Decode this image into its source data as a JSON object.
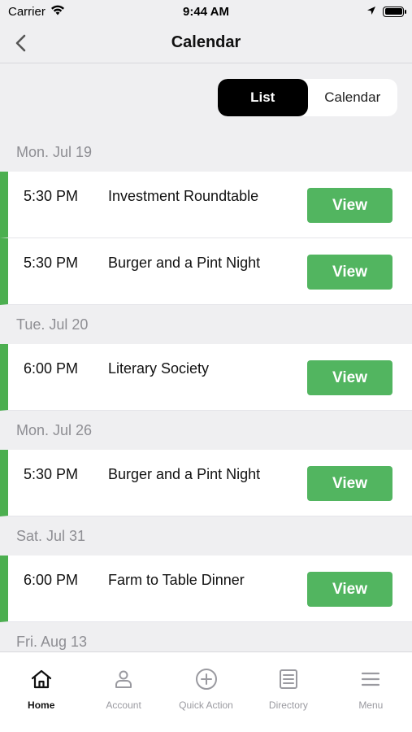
{
  "status_bar": {
    "carrier": "Carrier",
    "time": "9:44 AM"
  },
  "nav": {
    "title": "Calendar"
  },
  "view_toggle": {
    "list_label": "List",
    "calendar_label": "Calendar",
    "selected": "List"
  },
  "groups": [
    {
      "date": "Mon. Jul 19",
      "events": [
        {
          "time": "5:30 PM",
          "title": "Investment Roundtable",
          "action": "View"
        },
        {
          "time": "5:30 PM",
          "title": "Burger and a Pint Night",
          "action": "View"
        }
      ]
    },
    {
      "date": "Tue. Jul 20",
      "events": [
        {
          "time": "6:00 PM",
          "title": "Literary Society",
          "action": "View"
        }
      ]
    },
    {
      "date": "Mon. Jul 26",
      "events": [
        {
          "time": "5:30 PM",
          "title": "Burger and a Pint Night",
          "action": "View"
        }
      ]
    },
    {
      "date": "Sat. Jul 31",
      "events": [
        {
          "time": "6:00 PM",
          "title": "Farm to Table Dinner",
          "action": "View"
        }
      ]
    },
    {
      "date": "Fri. Aug 13",
      "events": []
    }
  ],
  "tabs": [
    {
      "label": "Home",
      "icon": "home-icon",
      "active": true
    },
    {
      "label": "Account",
      "icon": "user-icon",
      "active": false
    },
    {
      "label": "Quick Action",
      "icon": "plus-circle-icon",
      "active": false
    },
    {
      "label": "Directory",
      "icon": "directory-icon",
      "active": false
    },
    {
      "label": "Menu",
      "icon": "menu-icon",
      "active": false
    }
  ],
  "colors": {
    "accent_green": "#4caf50",
    "button_green": "#52b560"
  }
}
